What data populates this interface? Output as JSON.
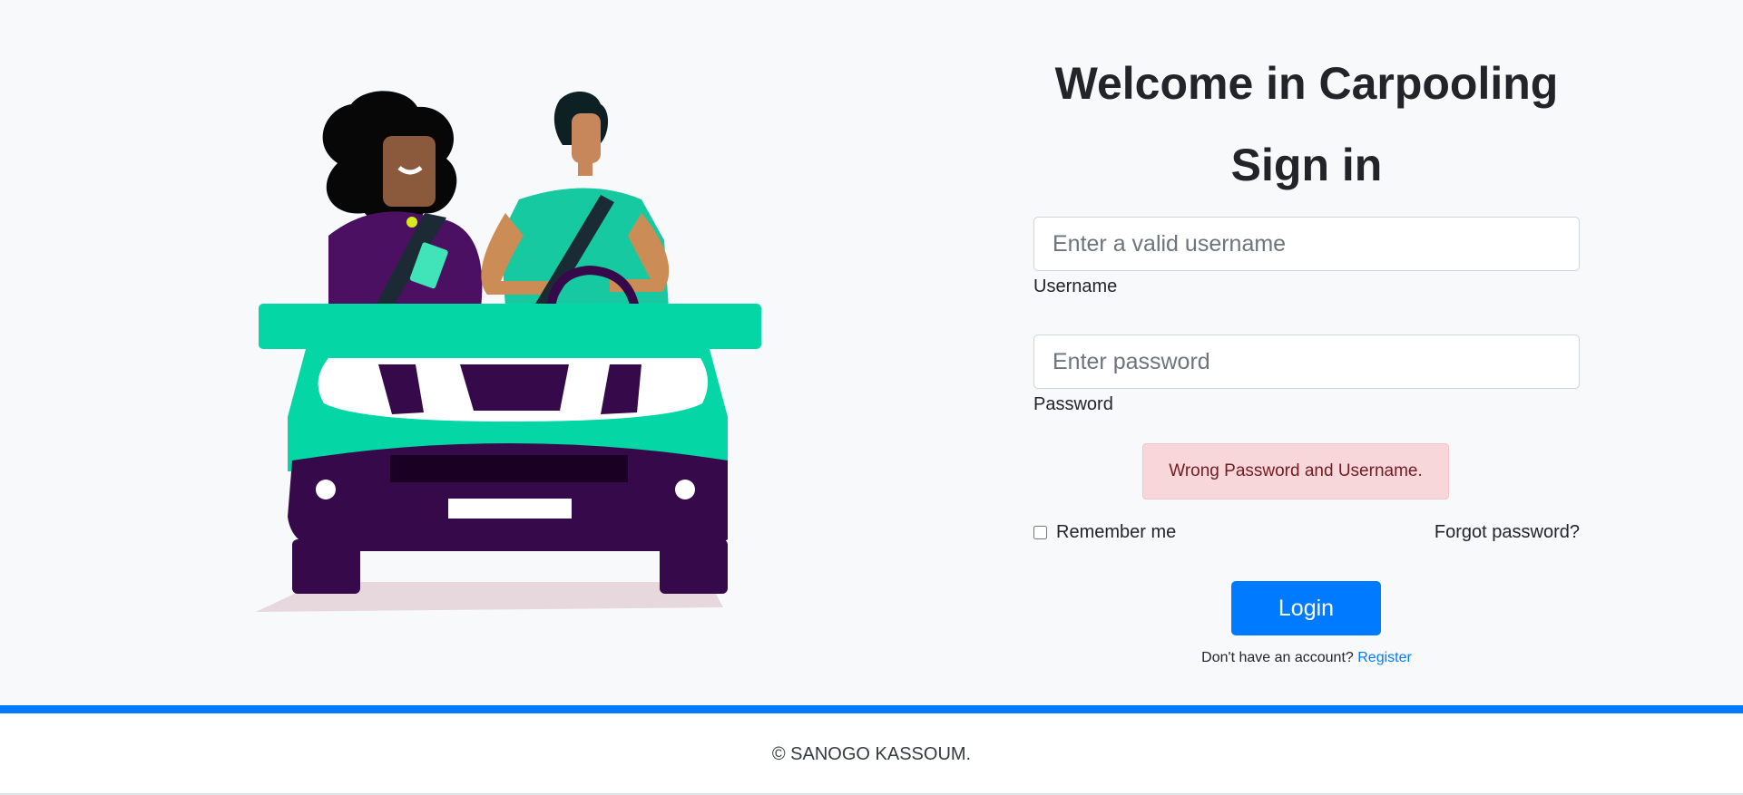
{
  "form": {
    "title": "Welcome in Carpooling",
    "subtitle": "Sign in",
    "username_placeholder": "Enter a valid username",
    "username_label": "Username",
    "password_placeholder": "Enter password",
    "password_label": "Password",
    "error_message": "Wrong Password and Username.",
    "remember_label": "Remember me",
    "forgot_label": "Forgot password?",
    "login_label": "Login",
    "register_prompt": "Don't have an account?",
    "register_link": "Register"
  },
  "footer": {
    "copyright": "© SANOGO KASSOUM."
  },
  "colors": {
    "accent": "#007bff",
    "error_bg": "#f8d7da",
    "error_text": "#721c24",
    "car_green": "#05d6a6",
    "car_purple": "#360a4a"
  }
}
